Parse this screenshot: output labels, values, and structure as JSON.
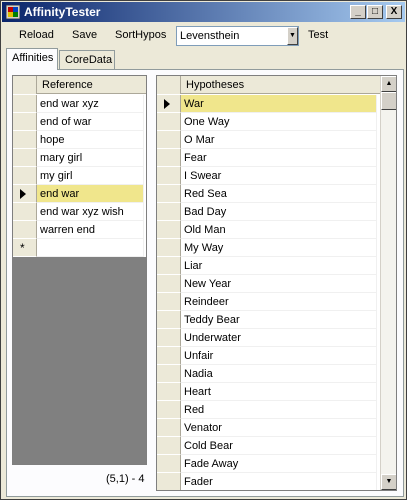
{
  "window": {
    "title": "AffinityTester",
    "minimize": "_",
    "maximize": "□",
    "close": "X"
  },
  "toolbar": {
    "reload": "Reload",
    "save": "Save",
    "sorthypos": "SortHypos",
    "algorithm_select": {
      "value": "Levensthein"
    },
    "test": "Test"
  },
  "tabs": [
    {
      "label": "Affinities",
      "active": true
    },
    {
      "label": "CoreData",
      "active": false
    }
  ],
  "reference_grid": {
    "column": "Reference",
    "rows": [
      "end war xyz",
      "end of war",
      "hope",
      "mary girl",
      "my girl",
      "end war",
      "end war xyz wish",
      "warren end"
    ],
    "selected_index": 5,
    "new_row_marker": "*"
  },
  "hypotheses_grid": {
    "column": "Hypotheses",
    "rows": [
      "War",
      "One Way",
      "O Mar",
      "Fear",
      "I Swear",
      "Red Sea",
      "Bad Day",
      "Old Man",
      "My Way",
      "Liar",
      "New Year",
      "Reindeer",
      "Teddy Bear",
      "Underwater",
      "Unfair",
      "Nadia",
      "Heart",
      "Red",
      "Venator",
      "Cold Bear",
      "Fade Away",
      "Fader"
    ],
    "selected_index": 0
  },
  "status": {
    "text": "(5,1) - 4"
  },
  "colors": {
    "selection": "#f0e68c",
    "titlebar_start": "#0a246a",
    "titlebar_end": "#a6caf0"
  }
}
